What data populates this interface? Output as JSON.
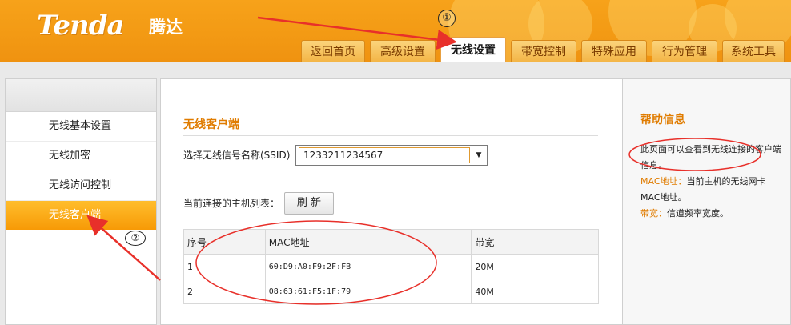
{
  "brand": {
    "logo_text": "Tenda",
    "logo_cn": "腾达"
  },
  "tabs": [
    {
      "label": "返回首页",
      "active": false
    },
    {
      "label": "高级设置",
      "active": false
    },
    {
      "label": "无线设置",
      "active": true
    },
    {
      "label": "带宽控制",
      "active": false
    },
    {
      "label": "特殊应用",
      "active": false
    },
    {
      "label": "行为管理",
      "active": false
    },
    {
      "label": "系统工具",
      "active": false
    }
  ],
  "sidebar": {
    "items": [
      {
        "label": "无线基本设置",
        "active": false
      },
      {
        "label": "无线加密",
        "active": false
      },
      {
        "label": "无线访问控制",
        "active": false
      },
      {
        "label": "无线客户端",
        "active": true
      }
    ]
  },
  "main": {
    "title": "无线客户端",
    "ssid_label": "选择无线信号名称(SSID)",
    "ssid_value": "1233211234567",
    "hosts_label": "当前连接的主机列表：",
    "refresh_label": "刷 新",
    "table": {
      "headers": [
        "序号",
        "MAC地址",
        "带宽"
      ],
      "rows": [
        [
          "1",
          "60:D9:A0:F9:2F:FB",
          "20M"
        ],
        [
          "2",
          "08:63:61:F5:1F:79",
          "40M"
        ]
      ]
    }
  },
  "help": {
    "title": "帮助信息",
    "intro": "此页面可以查看到无线连接的客户端信息。",
    "mac_key": "MAC地址：",
    "mac_desc": "当前主机的无线网卡MAC地址。",
    "bw_key": "带宽：",
    "bw_desc": "信道频率宽度。"
  },
  "annotations": {
    "marker1": "①",
    "marker2": "②"
  },
  "colors": {
    "header": "#f39a14",
    "accent": "#e07c00",
    "annotation": "#e8302a"
  }
}
